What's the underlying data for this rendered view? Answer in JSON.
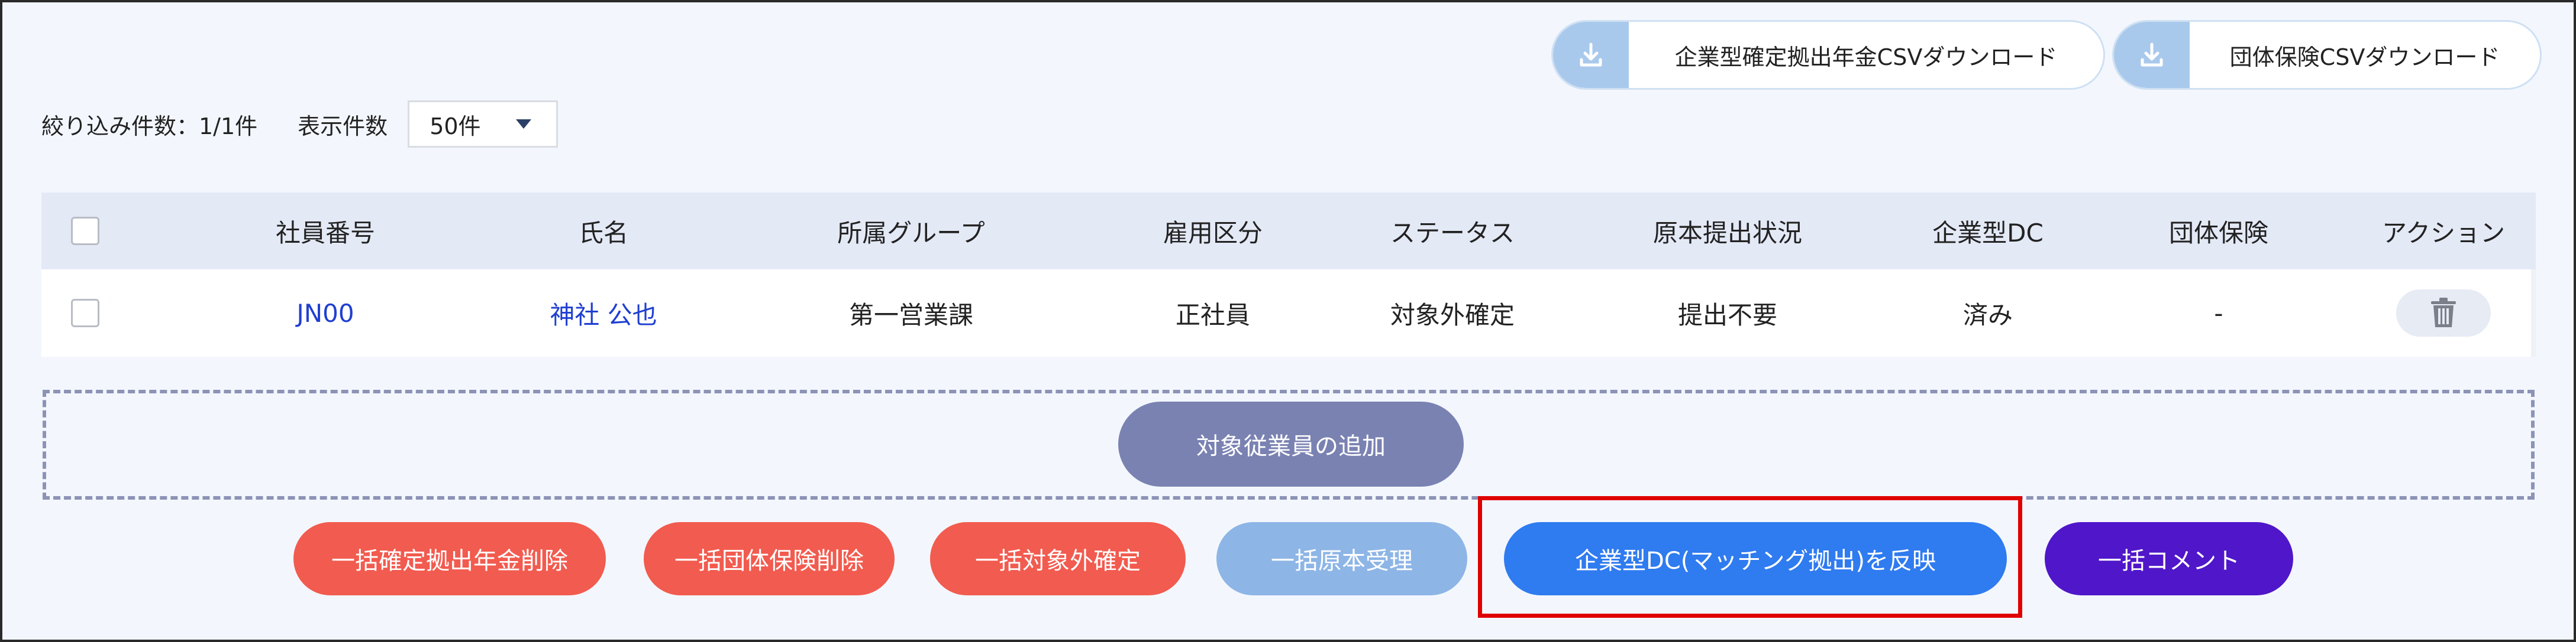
{
  "toolbar": {
    "dc_csv_label": "企業型確定拠出年金CSVダウンロード",
    "group_csv_label": "団体保険CSVダウンロード"
  },
  "filter": {
    "count_label": "絞り込み件数：1/1件",
    "per_page_label": "表示件数",
    "per_page_value": "50件"
  },
  "table": {
    "headers": [
      "社員番号",
      "氏名",
      "所属グループ",
      "雇用区分",
      "ステータス",
      "原本提出状況",
      "企業型DC",
      "団体保険",
      "アクション"
    ],
    "rows": [
      {
        "employee_id": "JN00",
        "name": "神社 公也",
        "group": "第一営業課",
        "employment": "正社員",
        "status": "対象外確定",
        "submission": "提出不要",
        "dc": "済み",
        "insurance": "-"
      }
    ]
  },
  "add_button_label": "対象従業員の追加",
  "bulk_actions": {
    "delete_dc": "一括確定拠出年金削除",
    "delete_insurance": "一括団体保険削除",
    "confirm_excluded": "一括対象外確定",
    "receive_original": "一括原本受理",
    "apply_dc_matching": "企業型DC(マッチング拠出)を反映",
    "comment": "一括コメント"
  },
  "colors": {
    "danger": "#f25b4f",
    "primary": "#2f7bf0",
    "disabled": "#8db5e6",
    "purple": "#5016c9",
    "highlight": "#e00000"
  },
  "icons": {
    "download": "download-icon",
    "dropdown": "caret-down-icon",
    "trash": "trash-icon"
  }
}
